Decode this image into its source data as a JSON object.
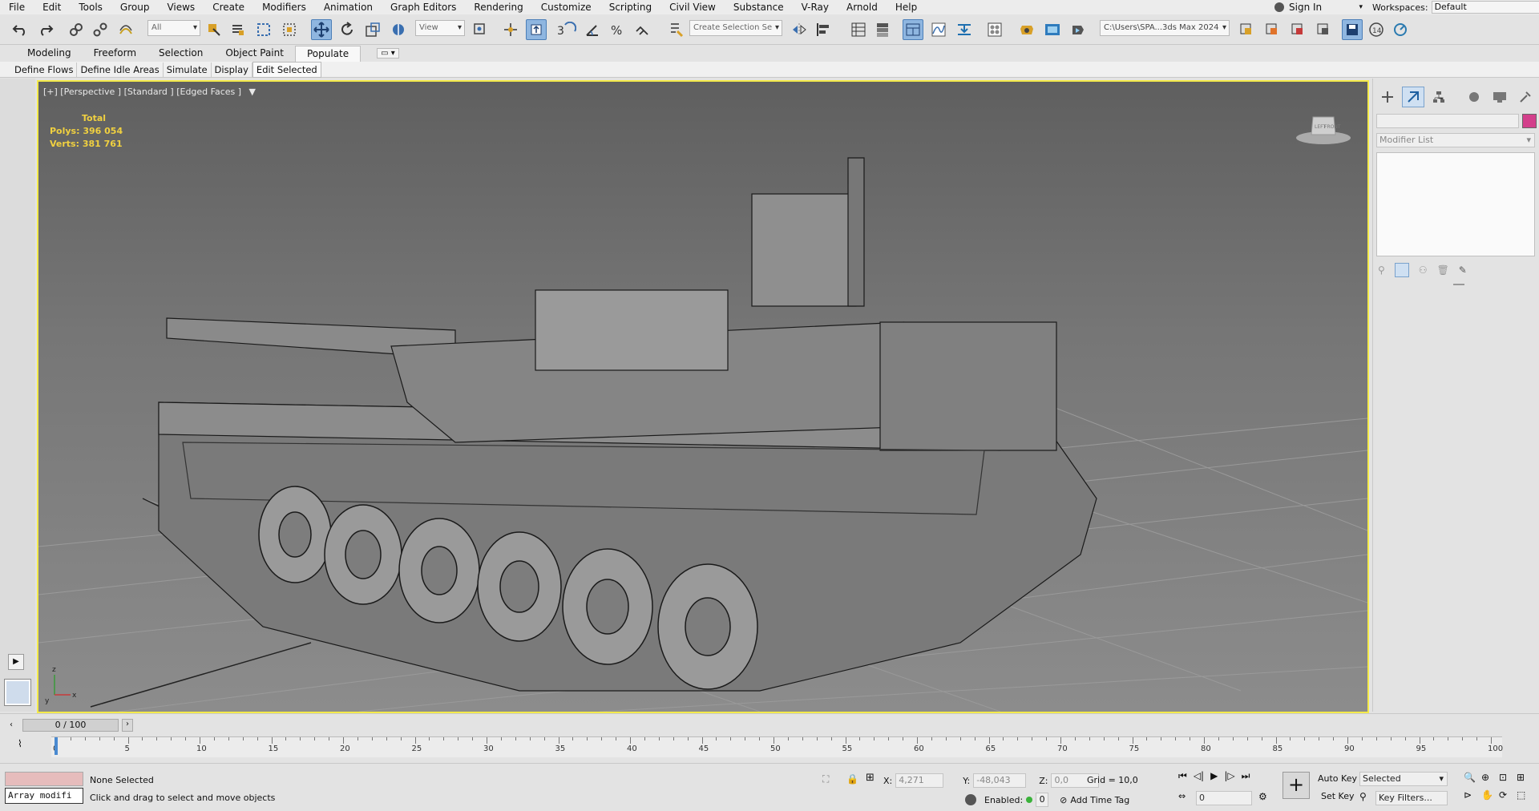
{
  "menu": [
    "File",
    "Edit",
    "Tools",
    "Group",
    "Views",
    "Create",
    "Modifiers",
    "Animation",
    "Graph Editors",
    "Rendering",
    "Customize",
    "Scripting",
    "Civil View",
    "Substance",
    "V-Ray",
    "Arnold",
    "Help"
  ],
  "signin": "Sign In",
  "workspaces": {
    "label": "Workspaces:",
    "value": "Default"
  },
  "toolbar": {
    "filter": "All",
    "ref_coord": "View",
    "selection_set": "Create Selection Se",
    "project_path": "C:\\Users\\SPA...3ds Max 2024"
  },
  "ribbon_tabs": [
    "Modeling",
    "Freeform",
    "Selection",
    "Object Paint",
    "Populate"
  ],
  "subtabs": [
    "Define Flows",
    "Define Idle Areas",
    "Simulate",
    "Display",
    "Edit Selected"
  ],
  "viewport": {
    "label": "[+] [Perspective ] [Standard ] [Edged Faces ]",
    "stats": {
      "total": "Total",
      "polys_label": "Polys:",
      "polys": "396 054",
      "verts_label": "Verts:",
      "verts": "381 761"
    },
    "viewcube_labels": {
      "left": "LEFT",
      "front": "FRONT"
    }
  },
  "right_panel": {
    "modifier_list": "Modifier List",
    "color": "#d33f8b"
  },
  "timeline": {
    "frame": "0 / 100",
    "ticks": [
      "0",
      "5",
      "10",
      "15",
      "20",
      "25",
      "30",
      "35",
      "40",
      "45",
      "50",
      "55",
      "60",
      "65",
      "70",
      "75",
      "80",
      "85",
      "90",
      "95",
      "100"
    ]
  },
  "status": {
    "script_listener": "Array modifi",
    "selection": "None Selected",
    "prompt": "Click and drag to select and move objects",
    "x_label": "X:",
    "x": "4,271",
    "y_label": "Y:",
    "y": "-48,043",
    "z_label": "Z:",
    "z": "0,0",
    "grid": "Grid = 10,0",
    "enabled_label": "Enabled:",
    "enabled_value": "0",
    "add_time_tag": "Add Time Tag",
    "auto_key": "Auto Key",
    "set_key": "Set Key",
    "key_mode": "Selected",
    "key_filters": "Key Filters...",
    "frame_field": "0"
  }
}
